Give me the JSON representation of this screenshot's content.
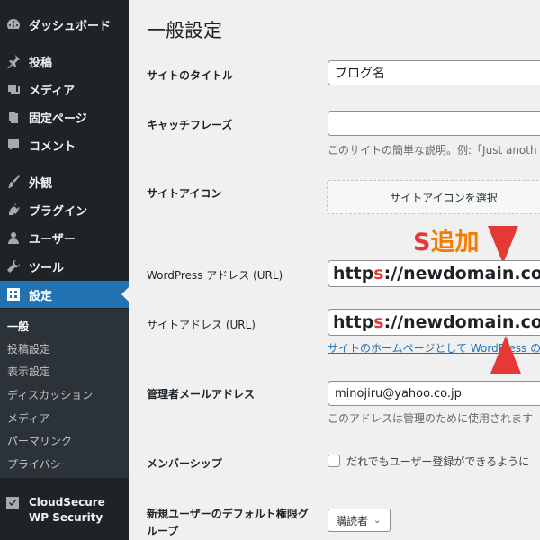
{
  "sidebar": {
    "items": [
      {
        "label": "ダッシュボード",
        "icon": "dashboard-icon"
      },
      {
        "label": "投稿",
        "icon": "pin-icon"
      },
      {
        "label": "メディア",
        "icon": "media-icon"
      },
      {
        "label": "固定ページ",
        "icon": "page-icon"
      },
      {
        "label": "コメント",
        "icon": "comment-icon"
      },
      {
        "label": "外観",
        "icon": "brush-icon"
      },
      {
        "label": "プラグイン",
        "icon": "plugin-icon"
      },
      {
        "label": "ユーザー",
        "icon": "user-icon"
      },
      {
        "label": "ツール",
        "icon": "wrench-icon"
      },
      {
        "label": "設定",
        "icon": "settings-icon"
      }
    ],
    "submenu": [
      "一般",
      "投稿設定",
      "表示設定",
      "ディスカッション",
      "メディア",
      "パーマリンク",
      "プライバシー"
    ],
    "cloudsecure_label": "CloudSecure WP Security"
  },
  "main": {
    "title": "一般設定",
    "site_title_label": "サイトのタイトル",
    "site_title_value": "ブログ名",
    "tagline_label": "キャッチフレーズ",
    "tagline_value": "",
    "tagline_desc": "このサイトの簡単な説明。例:「Just anoth",
    "site_icon_label": "サイトアイコン",
    "site_icon_button": "サイトアイコンを選択",
    "wp_address_label": "WordPress アドレス (URL)",
    "wp_address_prefix": "http",
    "wp_address_s": "s",
    "wp_address_suffix": "://newdomain.co",
    "site_address_label": "サイトアドレス (URL)",
    "site_address_prefix": "http",
    "site_address_s": "s",
    "site_address_suffix": "://newdomain.co",
    "site_address_desc": "サイトのホームページとして WordPress の",
    "admin_email_label": "管理者メールアドレス",
    "admin_email_value": "minojiru@yahoo.co.jp",
    "admin_email_desc": "このアドレスは管理のために使用されます",
    "membership_label": "メンバーシップ",
    "membership_checkbox_label": "だれでもユーザー登録ができるように",
    "default_role_label": "新規ユーザーのデフォルト権限グループ",
    "default_role_value": "購読者"
  },
  "annotation": {
    "s": "S",
    "text": "追加"
  }
}
